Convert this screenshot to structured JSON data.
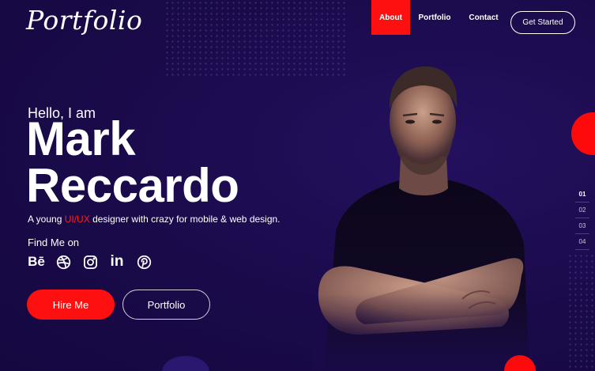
{
  "brand": {
    "logo": "Portfolio"
  },
  "nav": {
    "items": [
      {
        "label": "About",
        "active": true
      },
      {
        "label": "Portfolio",
        "active": false
      },
      {
        "label": "Contact",
        "active": false
      }
    ],
    "cta": "Get Started"
  },
  "hero": {
    "greeting": "Hello, I am",
    "first_name": "Mark",
    "last_name": "Reccardo",
    "tagline_pre": "A young ",
    "tagline_accent": "UI/UX",
    "tagline_post": " designer with crazy for mobile & web design.",
    "find_me": "Find Me on",
    "socials": [
      "behance-icon",
      "dribbble-icon",
      "instagram-icon",
      "linkedin-icon",
      "pinterest-icon"
    ],
    "behance_text": "Bē",
    "linkedin_text": "in",
    "hire_label": "Hire Me",
    "portfolio_label": "Portfolio"
  },
  "pager": [
    "01",
    "02",
    "03",
    "04"
  ],
  "colors": {
    "accent": "#ff1010",
    "background": "#1a0a4a"
  }
}
